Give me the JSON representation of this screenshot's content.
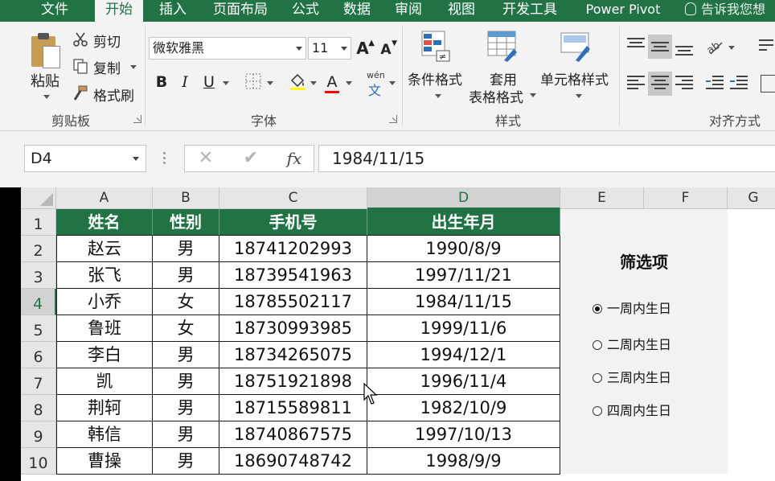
{
  "menu": {
    "tabs": [
      "文件",
      "开始",
      "插入",
      "页面布局",
      "公式",
      "数据",
      "审阅",
      "视图",
      "开发工具",
      "Power Pivot"
    ],
    "active": "开始",
    "tell_me": "告诉我您想"
  },
  "ribbon": {
    "clipboard": {
      "paste": "粘贴",
      "cut": "剪切",
      "copy": "复制",
      "format_painter": "格式刷",
      "label": "剪贴板"
    },
    "font": {
      "name": "微软雅黑",
      "size": "11",
      "grow": "A",
      "shrink": "A",
      "bold": "B",
      "italic": "I",
      "underline": "U",
      "font_color": "A",
      "phonetic_top": "wén",
      "phonetic_bottom": "文",
      "label": "字体"
    },
    "styles": {
      "conditional": "条件格式",
      "table_line1": "套用",
      "table_line2": "表格格式",
      "cell_styles": "单元格样式",
      "label": "样式"
    },
    "alignment": {
      "label": "对齐方式"
    }
  },
  "formula_bar": {
    "name_box": "D4",
    "cancel": "✕",
    "enter": "✔",
    "fx": "fx",
    "value": "1984/11/15"
  },
  "grid": {
    "columns": [
      "A",
      "B",
      "C",
      "D",
      "E",
      "F",
      "G"
    ],
    "rows": [
      "1",
      "2",
      "3",
      "4",
      "5",
      "6",
      "7",
      "8",
      "9",
      "10"
    ],
    "selected_column": "D",
    "selected_row": "4",
    "header": [
      "姓名",
      "性别",
      "手机号",
      "出生年月"
    ],
    "data": [
      [
        "赵云",
        "男",
        "18741202993",
        "1990/8/9"
      ],
      [
        "张飞",
        "男",
        "18739541963",
        "1997/11/21"
      ],
      [
        "小乔",
        "女",
        "18785502117",
        "1984/11/15"
      ],
      [
        "鲁班",
        "女",
        "18730993985",
        "1999/11/6"
      ],
      [
        "李白",
        "男",
        "18734265075",
        "1994/12/1"
      ],
      [
        "凯",
        "男",
        "18751921898",
        "1996/11/4"
      ],
      [
        "荆轲",
        "男",
        "18715589811",
        "1982/10/9"
      ],
      [
        "韩信",
        "男",
        "18740867575",
        "1997/10/13"
      ],
      [
        "曹操",
        "男",
        "18690748742",
        "1998/9/9"
      ]
    ]
  },
  "filter": {
    "title": "筛选项",
    "options": [
      "一周内生日",
      "二周内生日",
      "三周内生日",
      "四周内生日"
    ],
    "selected": "一周内生日"
  },
  "colors": {
    "accent": "#217346",
    "panel": "#f2f2f2"
  }
}
